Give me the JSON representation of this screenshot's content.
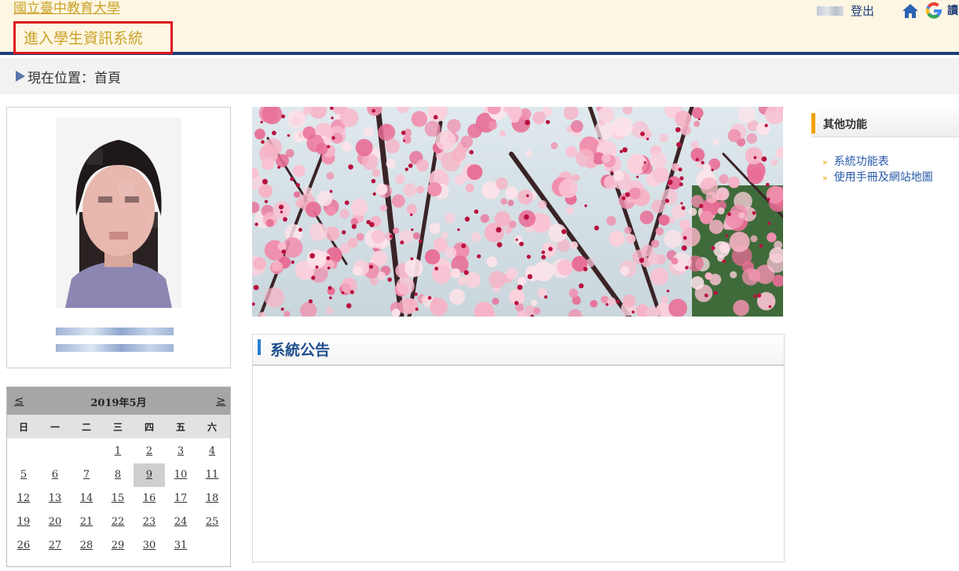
{
  "header": {
    "school_name": "國立臺中教育大學",
    "sis_link": "進入學生資訊系統",
    "logout": "登出",
    "lang": "讀"
  },
  "breadcrumb": {
    "text": "現在位置：首頁"
  },
  "calendar": {
    "prev": "≤",
    "next": "≥",
    "title": "2019年5月",
    "weekdays": [
      "日",
      "一",
      "二",
      "三",
      "四",
      "五",
      "六"
    ],
    "today": "9",
    "weeks": [
      [
        "",
        "",
        "",
        "1",
        "2",
        "3",
        "4"
      ],
      [
        "5",
        "6",
        "7",
        "8",
        "9",
        "10",
        "11"
      ],
      [
        "12",
        "13",
        "14",
        "15",
        "16",
        "17",
        "18"
      ],
      [
        "19",
        "20",
        "21",
        "22",
        "23",
        "24",
        "25"
      ],
      [
        "26",
        "27",
        "28",
        "29",
        "30",
        "31",
        ""
      ]
    ]
  },
  "announcement": {
    "title": "系統公告"
  },
  "sidebar": {
    "title": "其他功能",
    "links": [
      "系統功能表",
      "使用手冊及網站地圖"
    ]
  },
  "colors": {
    "header_bg": "#fdf6e3",
    "header_rule": "#1f3d7a",
    "highlight_box": "#e0161e",
    "gold_text": "#c9a227",
    "accent_orange": "#f0a20a",
    "accent_blue": "#2b7fd1"
  },
  "icons": {
    "home": "home-icon",
    "google": "google-icon",
    "breadcrumb": "triangle-right-icon"
  }
}
